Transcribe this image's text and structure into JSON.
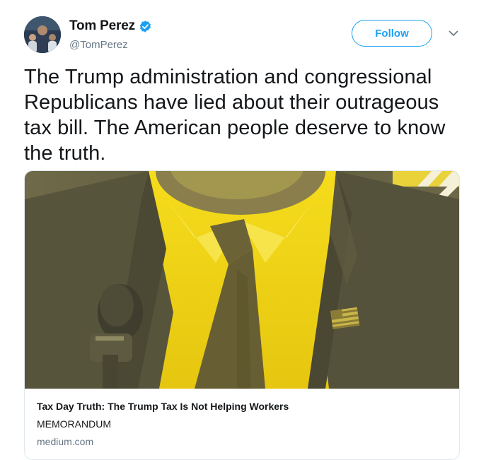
{
  "author": {
    "name": "Tom Perez",
    "handle": "@TomPerez",
    "verified": true
  },
  "actions": {
    "follow_label": "Follow"
  },
  "tweet": {
    "text": "The Trump administration and congressional Republicans have lied about their outrageous tax bill. The American people deserve to know the truth."
  },
  "card": {
    "title": "Tax Day Truth: The Trump Tax Is Not Helping Workers",
    "description": "MEMORANDUM",
    "domain": "medium.com",
    "image_icon": "duotone-photo-suit-tie-flag-pin"
  },
  "colors": {
    "brand_blue": "#1da1f2",
    "text": "#14171a",
    "secondary_text": "#657786",
    "card_border": "#e1e8ed",
    "image_yellow": "#f2d41a",
    "image_dark": "#4a4838"
  },
  "icons": {
    "verified": "verified-badge-icon",
    "more": "chevron-down-icon"
  }
}
